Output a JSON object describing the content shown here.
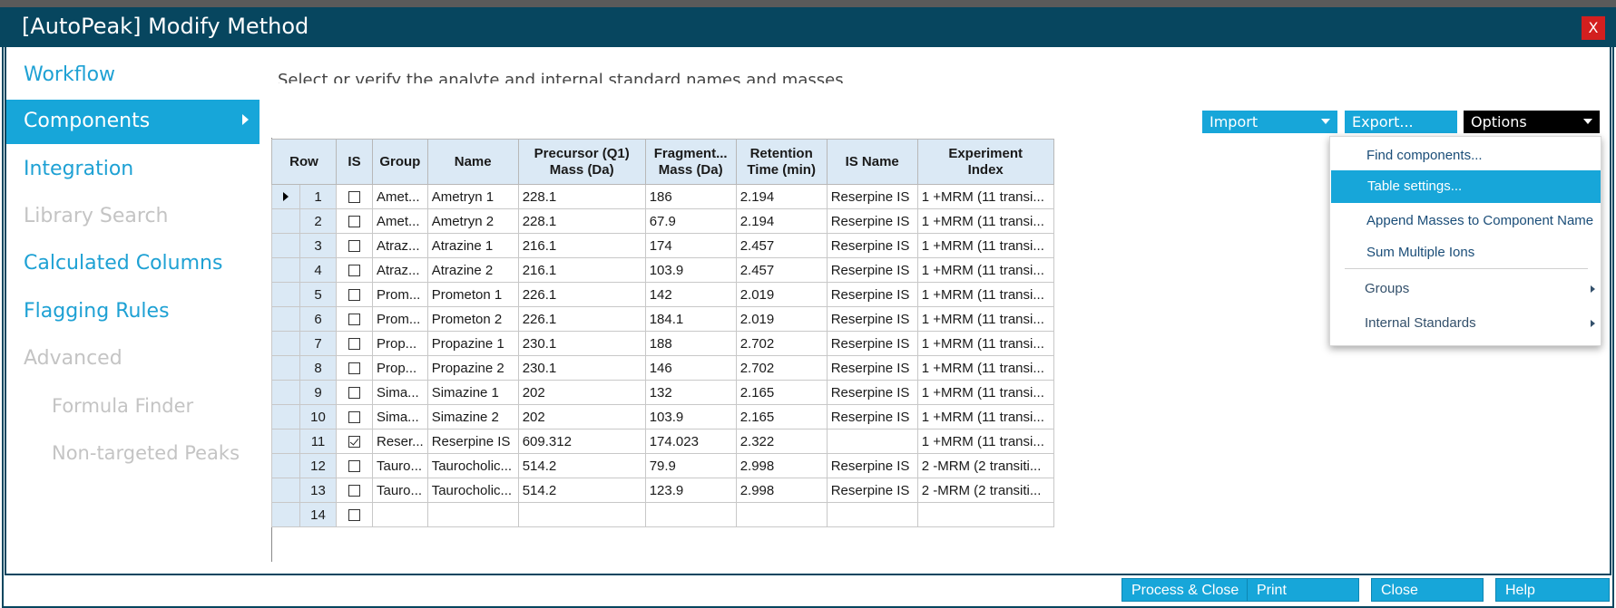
{
  "window": {
    "title": "[AutoPeak] Modify Method",
    "close_label": "X"
  },
  "nav": {
    "items": [
      {
        "label": "Workflow",
        "state": "enabled"
      },
      {
        "label": "Components",
        "state": "active"
      },
      {
        "label": "Integration",
        "state": "enabled"
      },
      {
        "label": "Library Search",
        "state": "disabled"
      },
      {
        "label": "Calculated Columns",
        "state": "enabled"
      },
      {
        "label": "Flagging Rules",
        "state": "enabled"
      },
      {
        "label": "Advanced",
        "state": "disabled"
      },
      {
        "label": "Formula Finder",
        "state": "disabled"
      },
      {
        "label": "Non-targeted Peaks",
        "state": "disabled"
      }
    ]
  },
  "main": {
    "instruction": "Select or verify the analyte and internal standard names and masses"
  },
  "toolbar": {
    "import_label": "Import",
    "export_label": "Export...",
    "options_label": "Options"
  },
  "table": {
    "headers": {
      "row": "Row",
      "is": "IS",
      "group": "Group",
      "name": "Name",
      "precursor_l1": "Precursor (Q1)",
      "precursor_l2": "Mass (Da)",
      "fragment_l1": "Fragment...",
      "fragment_l2": "Mass (Da)",
      "retention_l1": "Retention",
      "retention_l2": "Time (min)",
      "is_name": "IS Name",
      "experiment_l1": "Experiment",
      "experiment_l2": "Index"
    },
    "rows": [
      {
        "row": "1",
        "is": false,
        "group": "Amet...",
        "name": "Ametryn 1",
        "precursor": "228.1",
        "fragment": "186",
        "rt": "2.194",
        "is_name": "Reserpine IS",
        "exp": "1 +MRM (11 transi..."
      },
      {
        "row": "2",
        "is": false,
        "group": "Amet...",
        "name": "Ametryn 2",
        "precursor": "228.1",
        "fragment": "67.9",
        "rt": "2.194",
        "is_name": "Reserpine IS",
        "exp": "1 +MRM (11 transi..."
      },
      {
        "row": "3",
        "is": false,
        "group": "Atraz...",
        "name": "Atrazine 1",
        "precursor": "216.1",
        "fragment": "174",
        "rt": "2.457",
        "is_name": "Reserpine IS",
        "exp": "1 +MRM (11 transi..."
      },
      {
        "row": "4",
        "is": false,
        "group": "Atraz...",
        "name": "Atrazine 2",
        "precursor": "216.1",
        "fragment": "103.9",
        "rt": "2.457",
        "is_name": "Reserpine IS",
        "exp": "1 +MRM (11 transi..."
      },
      {
        "row": "5",
        "is": false,
        "group": "Prom...",
        "name": "Prometon 1",
        "precursor": "226.1",
        "fragment": "142",
        "rt": "2.019",
        "is_name": "Reserpine IS",
        "exp": "1 +MRM (11 transi..."
      },
      {
        "row": "6",
        "is": false,
        "group": "Prom...",
        "name": "Prometon 2",
        "precursor": "226.1",
        "fragment": "184.1",
        "rt": "2.019",
        "is_name": "Reserpine IS",
        "exp": "1 +MRM (11 transi..."
      },
      {
        "row": "7",
        "is": false,
        "group": "Prop...",
        "name": "Propazine 1",
        "precursor": "230.1",
        "fragment": "188",
        "rt": "2.702",
        "is_name": "Reserpine IS",
        "exp": "1 +MRM (11 transi..."
      },
      {
        "row": "8",
        "is": false,
        "group": "Prop...",
        "name": "Propazine 2",
        "precursor": "230.1",
        "fragment": "146",
        "rt": "2.702",
        "is_name": "Reserpine IS",
        "exp": "1 +MRM (11 transi..."
      },
      {
        "row": "9",
        "is": false,
        "group": "Sima...",
        "name": "Simazine 1",
        "precursor": "202",
        "fragment": "132",
        "rt": "2.165",
        "is_name": "Reserpine IS",
        "exp": "1 +MRM (11 transi..."
      },
      {
        "row": "10",
        "is": false,
        "group": "Sima...",
        "name": "Simazine 2",
        "precursor": "202",
        "fragment": "103.9",
        "rt": "2.165",
        "is_name": "Reserpine IS",
        "exp": "1 +MRM (11 transi..."
      },
      {
        "row": "11",
        "is": true,
        "group": "Reser...",
        "name": "Reserpine IS",
        "precursor": "609.312",
        "fragment": "174.023",
        "rt": "2.322",
        "is_name": "",
        "exp": "1 +MRM (11 transi..."
      },
      {
        "row": "12",
        "is": false,
        "group": "Tauro...",
        "name": "Taurocholic...",
        "precursor": "514.2",
        "fragment": "79.9",
        "rt": "2.998",
        "is_name": "Reserpine IS",
        "exp": "2 -MRM (2 transiti..."
      },
      {
        "row": "13",
        "is": false,
        "group": "Tauro...",
        "name": "Taurocholic...",
        "precursor": "514.2",
        "fragment": "123.9",
        "rt": "2.998",
        "is_name": "Reserpine IS",
        "exp": "2 -MRM (2 transiti..."
      },
      {
        "row": "14",
        "is": false,
        "group": "",
        "name": "",
        "precursor": "",
        "fragment": "",
        "rt": "",
        "is_name": "",
        "exp": ""
      }
    ]
  },
  "options_menu": {
    "items": [
      {
        "label": "Find components...",
        "highlighted": false,
        "submenu": false
      },
      {
        "label": "Table settings...",
        "highlighted": true,
        "submenu": false
      },
      {
        "label": "Append Masses to Component Name",
        "highlighted": false,
        "submenu": false
      },
      {
        "label": "Sum Multiple Ions",
        "highlighted": false,
        "submenu": false
      },
      {
        "label": "Groups",
        "highlighted": false,
        "submenu": true
      },
      {
        "label": "Internal Standards",
        "highlighted": false,
        "submenu": true
      }
    ]
  },
  "footer": {
    "process_close_label": "Process & Close",
    "print_label": "Print",
    "close_label": "Close",
    "help_label": "Help"
  },
  "colors": {
    "title_bar": "#07465f",
    "accent": "#17a6d9",
    "close_button": "#d31f1f",
    "header_fill": "#dbe9f5"
  }
}
